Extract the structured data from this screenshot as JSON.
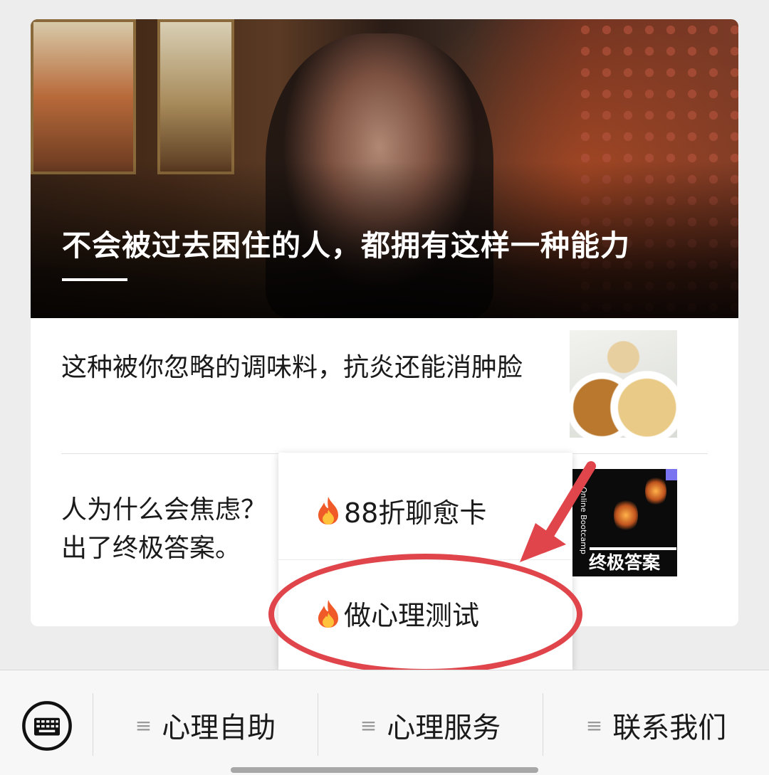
{
  "hero": {
    "title": "不会被过去困住的人，都拥有这样一种能力"
  },
  "articles": [
    {
      "title": "这种被你忽略的调味料，抗炎还能消肿脸"
    },
    {
      "title": "人为什么会焦虑？",
      "title_line2": "出了终极答案。"
    }
  ],
  "thumb2": {
    "vertical_text": "Online Bootcamp",
    "caption": "终极答案"
  },
  "popup_menu": {
    "items": [
      {
        "label": "88折聊愈卡",
        "icon": "fire-icon"
      },
      {
        "label": "做心理测试",
        "icon": "fire-icon"
      }
    ]
  },
  "bottom_menu": {
    "keyboard_icon": "keyboard-icon",
    "items": [
      {
        "label": "心理自助"
      },
      {
        "label": "心理服务"
      },
      {
        "label": "联系我们"
      }
    ],
    "menu_icon_glyph": "≡"
  },
  "colors": {
    "highlight": "#e0454b",
    "background": "#ededed"
  }
}
